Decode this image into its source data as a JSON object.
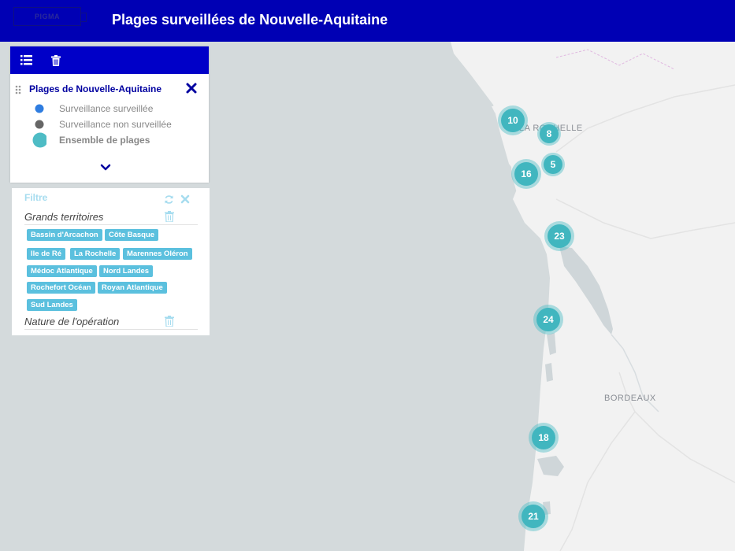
{
  "header": {
    "logo_text": "PIGMA",
    "title": "Plages surveillées de Nouvelle-Aquitaine"
  },
  "icons": {
    "toolbar": [
      "list-icon",
      "trash-icon"
    ],
    "layer": [
      "drag-handle-icon",
      "close-icon",
      "chevron-down-icon"
    ],
    "filter": [
      "refresh-icon",
      "close-icon",
      "trash-icon"
    ]
  },
  "colors": {
    "header": "#0000b4",
    "toolbar": "#0000c8",
    "surveillee": "#2f7de0",
    "non_surveillee": "#666666",
    "cluster": "#41b6bf",
    "tag": "#5bc0de"
  },
  "legend": {
    "layer_title": "Plages de Nouvelle-Aquitaine",
    "items": [
      {
        "label": "Surveillance surveillée"
      },
      {
        "label": "Surveillance non surveillée"
      },
      {
        "label": "Ensemble de plages"
      }
    ]
  },
  "filter": {
    "title": "Filtre",
    "sections": [
      {
        "label": "Grands territoires",
        "tags": [
          "Bassin d'Arcachon",
          "Côte Basque",
          "Ile de Ré",
          "La Rochelle",
          "Marennes Oléron",
          "Médoc Atlantique",
          "Nord Landes",
          "Rochefort Océan",
          "Royan Atlantique",
          "Sud Landes"
        ]
      },
      {
        "label": "Nature de l'opération",
        "tags": []
      }
    ]
  },
  "map": {
    "cities": [
      "LA ROCHELLE",
      "BORDEAUX"
    ],
    "clusters": [
      "10",
      "8",
      "5",
      "16",
      "23",
      "24",
      "18",
      "21"
    ]
  }
}
